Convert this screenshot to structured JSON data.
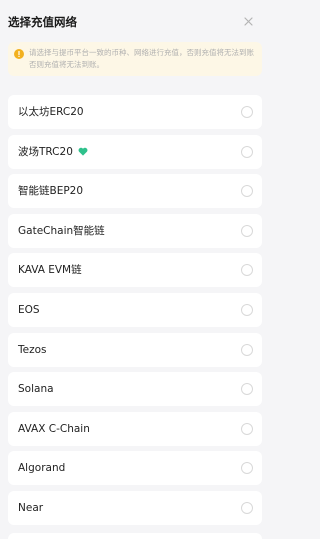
{
  "header": {
    "title": "选择充值网络",
    "close_icon": "close-icon"
  },
  "notice": {
    "icon": "info-icon",
    "text": "请选择与提币平台一致的币种、网络进行充值，否则充值将无法到账否则充值将无法到账。",
    "color": "#f2b01e"
  },
  "networks": [
    {
      "label": "以太坊ERC20"
    },
    {
      "label": "波场TRC20",
      "badge_icon": "heart-icon",
      "badge_color": "#2fc18c"
    },
    {
      "label": "智能链BEP20"
    },
    {
      "label": "GateChain智能链"
    },
    {
      "label": "KAVA EVM链"
    },
    {
      "label": "EOS"
    },
    {
      "label": "Tezos"
    },
    {
      "label": "Solana"
    },
    {
      "label": "AVAX C-Chain"
    },
    {
      "label": "Algorand"
    },
    {
      "label": "Near"
    }
  ]
}
